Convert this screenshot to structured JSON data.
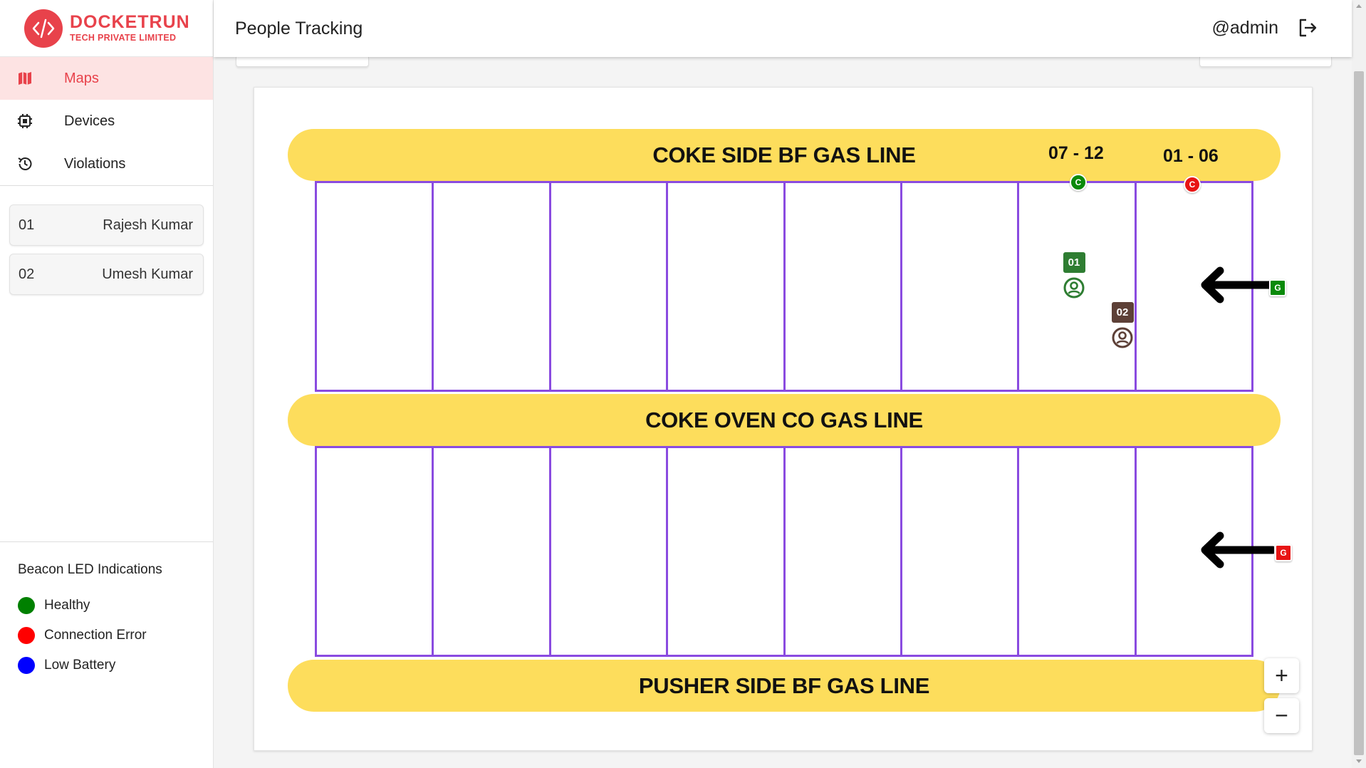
{
  "brand": {
    "name": "DOCKETRUN",
    "subtitle": "TECH PRIVATE LIMITED",
    "color": "#e8424b"
  },
  "header": {
    "title": "People Tracking",
    "user": "@admin"
  },
  "nav": {
    "items": [
      {
        "label": "Maps",
        "icon": "map-icon",
        "active": true
      },
      {
        "label": "Devices",
        "icon": "chip-icon",
        "active": false
      },
      {
        "label": "Violations",
        "icon": "history-icon",
        "active": false
      }
    ]
  },
  "people": [
    {
      "id": "01",
      "name": "Rajesh Kumar"
    },
    {
      "id": "02",
      "name": "Umesh Kumar"
    }
  ],
  "legend": {
    "title": "Beacon LED Indications",
    "items": [
      {
        "label": "Healthy",
        "color": "#008000"
      },
      {
        "label": "Connection Error",
        "color": "#ff0000"
      },
      {
        "label": "Low Battery",
        "color": "#0000ff"
      }
    ]
  },
  "map": {
    "gas_lines": [
      "COKE SIDE BF GAS LINE",
      "COKE OVEN CO GAS LINE",
      "PUSHER SIDE BF GAS LINE"
    ],
    "range_labels": [
      "07 - 12",
      "01 - 06"
    ],
    "beacons": [
      {
        "label": "C",
        "status": "healthy",
        "color": "#0a8a0a"
      },
      {
        "label": "C",
        "status": "connection-error",
        "color": "#e81515"
      }
    ],
    "gates": [
      {
        "label": "G",
        "status": "healthy",
        "color": "#0a8a0a"
      },
      {
        "label": "G",
        "status": "connection-error",
        "color": "#e81515"
      }
    ],
    "markers": [
      {
        "id": "01",
        "color": "#2e7d32"
      },
      {
        "id": "02",
        "color": "#5d4037"
      }
    ],
    "zoom_in": "+",
    "zoom_out": "−"
  }
}
